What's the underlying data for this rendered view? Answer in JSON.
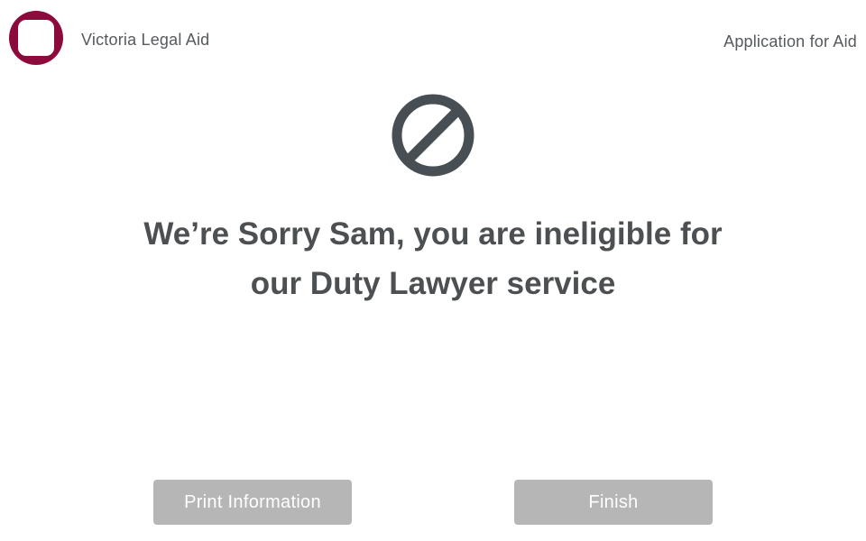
{
  "header": {
    "org_name": "Victoria Legal Aid",
    "app_title": "Application for Aid",
    "logo_icon": "vla-logo",
    "brand_color": "#8c0a3c"
  },
  "status": {
    "icon": "prohibited-icon",
    "icon_color": "#474f54",
    "message_line1": "We’re Sorry Sam, you are ineligible for",
    "message_line2": "our Duty Lawyer service"
  },
  "actions": {
    "print_label": "Print Information",
    "finish_label": "Finish",
    "button_color": "#b6b6b6"
  }
}
